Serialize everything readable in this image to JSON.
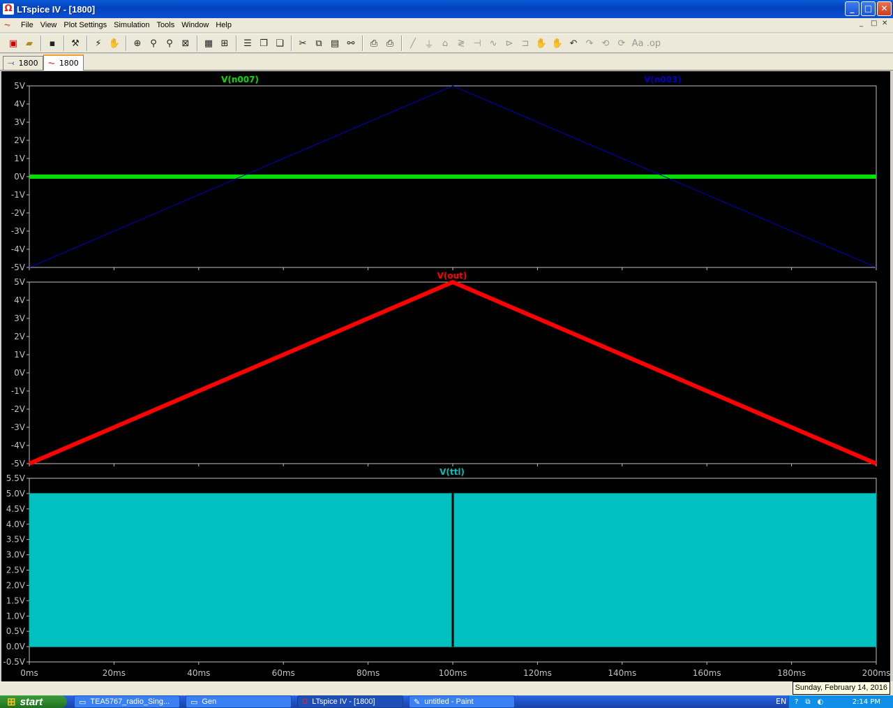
{
  "window": {
    "title": "LTspice IV - [1800]",
    "minimize": "_",
    "maximize": "□",
    "close": "✕"
  },
  "menu": [
    "File",
    "View",
    "Plot Settings",
    "Simulation",
    "Tools",
    "Window",
    "Help"
  ],
  "mdi_buttons": [
    "_",
    "□",
    "✕"
  ],
  "tabs": [
    {
      "label": "1800",
      "icon": "schematic-icon"
    },
    {
      "label": "1800",
      "icon": "waveform-icon"
    }
  ],
  "plot": {
    "x_ticks": [
      "0ms",
      "20ms",
      "40ms",
      "60ms",
      "80ms",
      "100ms",
      "120ms",
      "140ms",
      "160ms",
      "180ms",
      "200ms"
    ],
    "pane1": {
      "traces": [
        {
          "name": "V(n007)",
          "color": "#00e000"
        },
        {
          "name": "V(n003)",
          "color": "#0000c0"
        }
      ],
      "y_ticks": [
        "5V",
        "4V",
        "3V",
        "2V",
        "1V",
        "0V",
        "-1V",
        "-2V",
        "-3V",
        "-4V",
        "-5V"
      ]
    },
    "pane2": {
      "traces": [
        {
          "name": "V(out)",
          "color": "#ff0000"
        }
      ],
      "y_ticks": [
        "5V",
        "4V",
        "3V",
        "2V",
        "1V",
        "0V",
        "-1V",
        "-2V",
        "-3V",
        "-4V",
        "-5V"
      ]
    },
    "pane3": {
      "traces": [
        {
          "name": "V(ttl)",
          "color": "#00c0c0"
        }
      ],
      "y_ticks": [
        "5.5V",
        "5.0V",
        "4.5V",
        "4.0V",
        "3.5V",
        "3.0V",
        "2.5V",
        "2.0V",
        "1.5V",
        "1.0V",
        "0.5V",
        "0.0V",
        "-0.5V"
      ]
    }
  },
  "chart_data": [
    {
      "type": "line",
      "series": [
        {
          "name": "V(n007)",
          "x": [
            0,
            200
          ],
          "y": [
            0,
            0
          ]
        },
        {
          "name": "V(n003)",
          "x": [
            0,
            100,
            200
          ],
          "y": [
            -5,
            5,
            -5
          ]
        }
      ],
      "xlim": [
        0,
        200
      ],
      "ylim": [
        -5,
        5
      ],
      "x_unit": "ms",
      "y_unit": "V"
    },
    {
      "type": "line",
      "series": [
        {
          "name": "V(out)",
          "x": [
            0,
            100,
            200
          ],
          "y": [
            -5,
            5,
            -5
          ]
        }
      ],
      "xlim": [
        0,
        200
      ],
      "ylim": [
        -5,
        5
      ],
      "x_unit": "ms",
      "y_unit": "V"
    },
    {
      "type": "area",
      "series": [
        {
          "name": "V(ttl)",
          "x": [
            0,
            99.8,
            100,
            100.3,
            200
          ],
          "y": [
            5,
            5,
            0,
            5,
            5
          ]
        }
      ],
      "xlim": [
        0,
        200
      ],
      "ylim": [
        -0.5,
        5.5
      ],
      "x_unit": "ms",
      "y_unit": "V"
    }
  ],
  "status": {
    "clock_tooltip": "Sunday, February 14, 2016"
  },
  "taskbar": {
    "start": "start",
    "tasks": [
      {
        "label": "TEA5767_radio_Sing...",
        "icon": "folder-icon"
      },
      {
        "label": "Gen",
        "icon": "folder-icon"
      },
      {
        "label": "LTspice IV - [1800]",
        "icon": "ltspice-icon"
      },
      {
        "label": "untitled - Paint",
        "icon": "paint-icon"
      }
    ],
    "lang": "EN",
    "time": "2:14 PM"
  }
}
